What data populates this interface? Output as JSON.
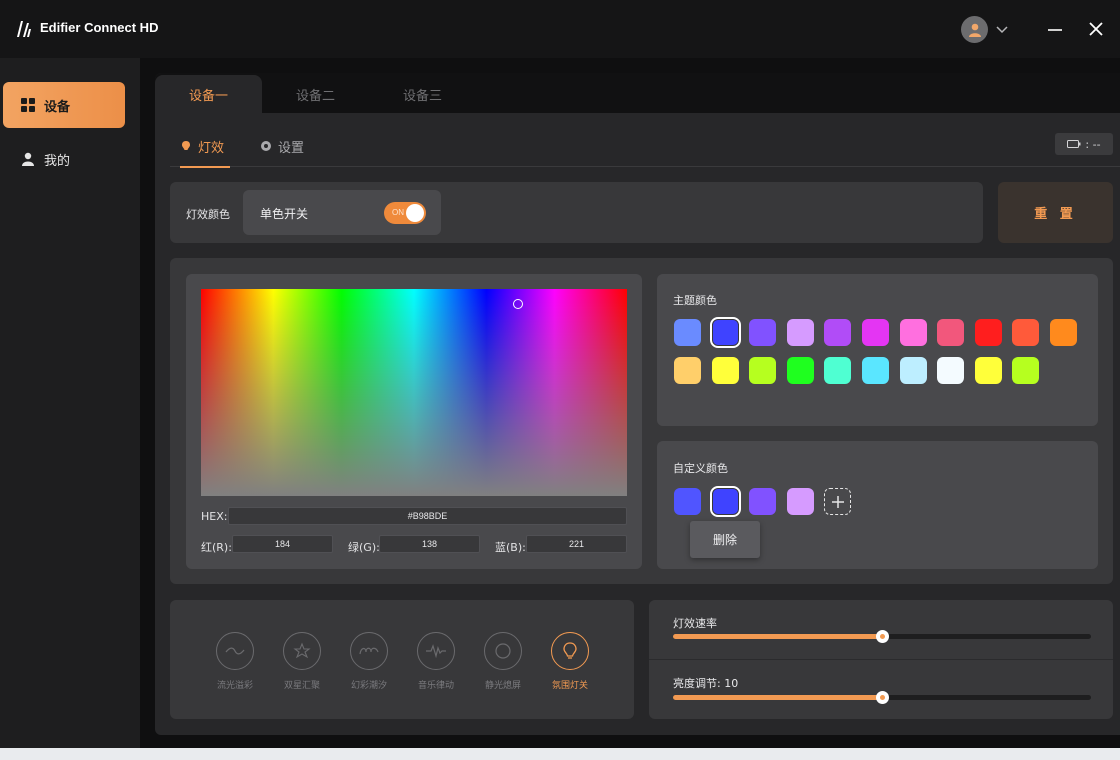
{
  "app": {
    "title": "Edifier Connect HD"
  },
  "window": {
    "avatar_icon": "user-icon",
    "dropdown_icon": "chevron-down-icon",
    "minimize_icon": "minimize-icon",
    "close_icon": "close-icon"
  },
  "sidebar": {
    "items": [
      {
        "label": "设备",
        "icon": "grid-icon",
        "active": true
      },
      {
        "label": "我的",
        "icon": "user-icon",
        "active": false
      }
    ]
  },
  "device_tabs": [
    "设备一",
    "设备二",
    "设备三"
  ],
  "sub_tabs": [
    {
      "label": "灯效",
      "icon": "bulb-icon",
      "active": true
    },
    {
      "label": "设置",
      "icon": "gear-icon",
      "active": false
    }
  ],
  "battery": {
    "text": ": --",
    "icon": "battery-icon"
  },
  "light_color": {
    "label": "灯效颜色",
    "mono_label": "单色开关",
    "toggle_on": true,
    "toggle_text": "ON"
  },
  "reset_label": "重 置",
  "picker": {
    "hex_label": "HEX:",
    "hex_value": "#B98BDE",
    "r_label": "红(R):",
    "r_value": "184",
    "g_label": "绿(G):",
    "g_value": "138",
    "b_label": "蓝(B):",
    "b_value": "221"
  },
  "theme_colors": {
    "title": "主题颜色",
    "swatches": [
      "#6a8bff",
      "#3f43ff",
      "#8152ff",
      "#d69bff",
      "#b14cf7",
      "#e435f3",
      "#ff6fdf",
      "#f2577c",
      "#ff1e1e",
      "#ff5a3a",
      "#ff8a1d",
      "#ffcf6a",
      "#ffff3a",
      "#b6ff1f",
      "#1fff1f",
      "#4fffd2",
      "#5ae6ff",
      "#bdeeff",
      "#f4fbff",
      "#ffff3a",
      "#b6ff1f"
    ],
    "selected_index": 1
  },
  "custom_colors": {
    "title": "自定义颜色",
    "swatches": [
      "#5055ff",
      "#3f43ff",
      "#8152ff",
      "#d69bff"
    ],
    "selected_index": 1,
    "add_icon": "plus-icon",
    "context_menu": "删除"
  },
  "effects": [
    {
      "label": "流光溢彩",
      "icon": "wave-icon",
      "active": false
    },
    {
      "label": "双星汇聚",
      "icon": "stars-icon",
      "active": false
    },
    {
      "label": "幻彩潮汐",
      "icon": "tide-icon",
      "active": false
    },
    {
      "label": "音乐律动",
      "icon": "music-wave-icon",
      "active": false
    },
    {
      "label": "静光熄屏",
      "icon": "circle-icon",
      "active": false
    },
    {
      "label": "氛围灯关",
      "icon": "bulb-icon",
      "active": true
    }
  ],
  "sliders": {
    "speed": {
      "label": "灯效速率",
      "value_fraction": 0.5
    },
    "brightness": {
      "label": "亮度调节: 10",
      "value_fraction": 0.5
    }
  },
  "colors": {
    "accent": "#f29a52",
    "background": "#0f0f10"
  }
}
